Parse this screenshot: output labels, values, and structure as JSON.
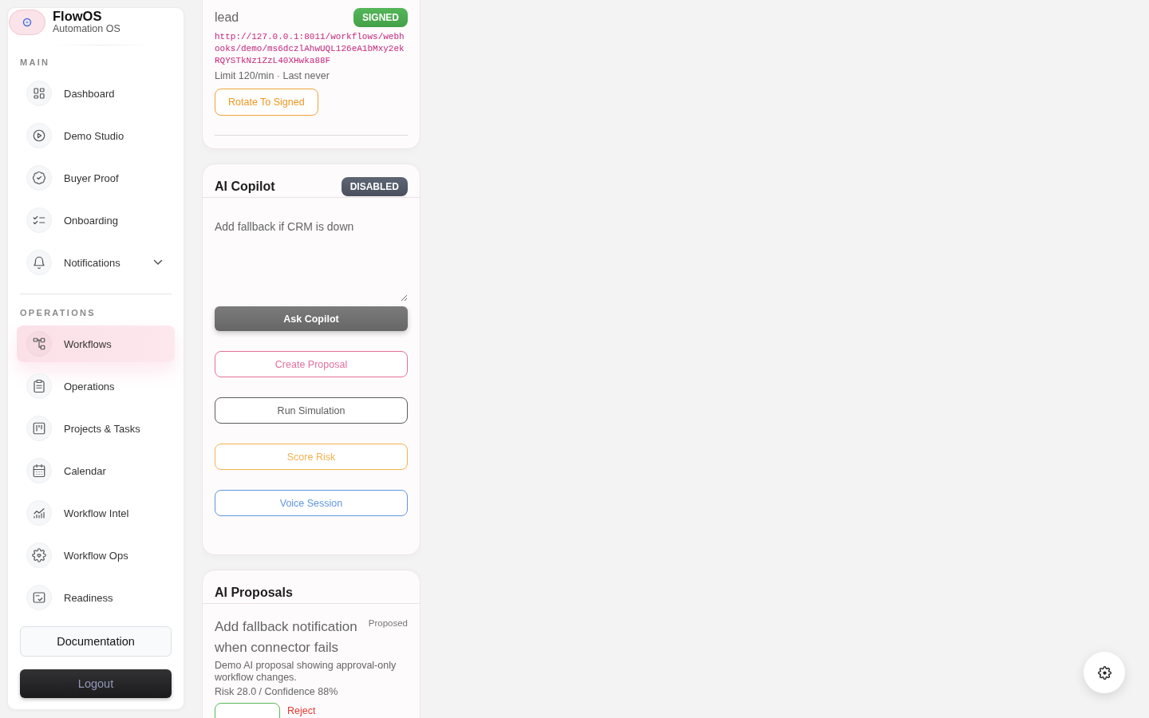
{
  "sidebar": {
    "brand": {
      "name": "FlowOS",
      "subtitle": "Automation OS"
    },
    "sections": [
      {
        "title": "MAIN",
        "items": [
          {
            "label": "Dashboard",
            "kind": "link",
            "selected": false
          },
          {
            "label": "Demo Studio",
            "kind": "link",
            "selected": false
          },
          {
            "label": "Buyer Proof",
            "kind": "link",
            "selected": false
          },
          {
            "label": "Onboarding",
            "kind": "link",
            "selected": false
          },
          {
            "label": "Notifications",
            "kind": "group",
            "expanded": false,
            "selected": false
          }
        ]
      },
      {
        "title": "OPERATIONS",
        "items": [
          {
            "label": "Workflows",
            "kind": "link",
            "selected": true
          },
          {
            "label": "Operations",
            "kind": "link",
            "selected": false
          },
          {
            "label": "Projects & Tasks",
            "kind": "link",
            "selected": false
          },
          {
            "label": "Calendar",
            "kind": "link",
            "selected": false
          },
          {
            "label": "Workflow Intel",
            "kind": "link",
            "selected": false
          },
          {
            "label": "Workflow Ops",
            "kind": "link",
            "selected": false
          },
          {
            "label": "Readiness",
            "kind": "link",
            "selected": false
          }
        ]
      }
    ],
    "documentation_button": "Documentation",
    "logout_button": "Logout"
  },
  "webhook": {
    "name": "lead",
    "status": {
      "label": "SIGNED",
      "kind": "signed"
    },
    "url": "http://127.0.0.1:8011/workflows/webhooks/demo/ms6dczlAhwUQL126eA1bMxy2ekRQYSTkNz1ZzL40XHwka88F",
    "meta": "Limit 120/min · Last never",
    "rotate_button": "Rotate To Signed"
  },
  "copilot": {
    "title": "AI Copilot",
    "status": {
      "label": "DISABLED",
      "kind": "disabled"
    },
    "prompt": {
      "value": "Add fallback if CRM is down"
    },
    "ask_button": {
      "label": "Ask Copilot",
      "disabled": true
    },
    "actions": [
      {
        "label": "Create Proposal",
        "color": "#e3709b"
      },
      {
        "label": "Run Simulation",
        "color": "#5c5c5c"
      },
      {
        "label": "Score Risk",
        "color": "#f5b24f"
      },
      {
        "label": "Voice Session",
        "color": "#6196dc"
      }
    ]
  },
  "proposals": {
    "title": "AI Proposals",
    "items": [
      {
        "title": "Add fallback notification when connector fails",
        "status": "Proposed",
        "description": "Demo AI proposal showing approval-only workflow changes.",
        "metrics": "Risk 28.0 / Confidence 88%",
        "actions": [
          {
            "kind": "outline"
          },
          {
            "kind": "link",
            "label": "Reject"
          }
        ]
      }
    ]
  }
}
